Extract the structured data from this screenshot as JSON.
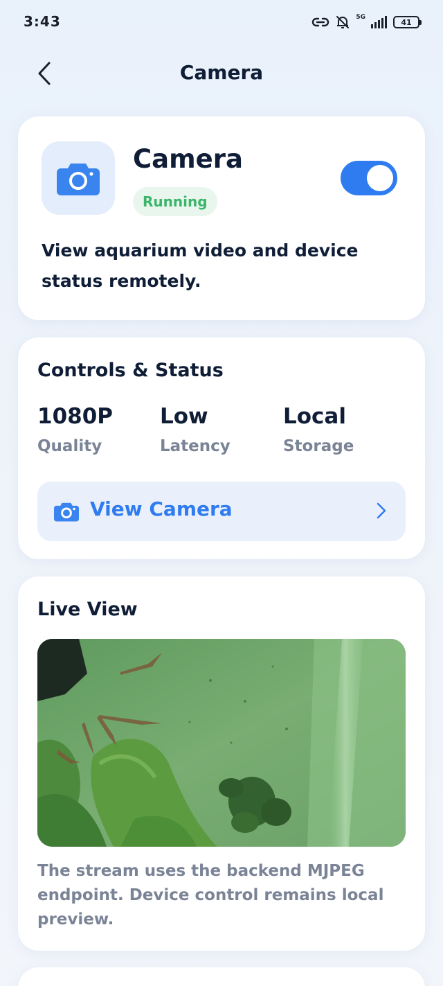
{
  "status_bar": {
    "time": "3:43",
    "network": "5G",
    "battery": "41",
    "icons": [
      "link-icon",
      "bell-muted-icon",
      "signal-icon",
      "battery-icon"
    ]
  },
  "header": {
    "title": "Camera",
    "back_icon": "chevron-left-icon"
  },
  "app_card": {
    "icon": "camera-icon",
    "name": "Camera",
    "status": "Running",
    "enabled": true,
    "description": "View aquarium video and device status remotely."
  },
  "controls": {
    "title": "Controls & Status",
    "stats": [
      {
        "value": "1080P",
        "label": "Quality"
      },
      {
        "value": "Low",
        "label": "Latency"
      },
      {
        "value": "Local",
        "label": "Storage"
      }
    ],
    "view_camera": {
      "label": "View Camera",
      "icon": "camera-icon",
      "chevron": "chevron-right-icon"
    }
  },
  "live_view": {
    "title": "Live View",
    "note": "The stream uses the backend MJPEG endpoint. Device control remains local preview."
  },
  "colors": {
    "accent": "#2f7bf0",
    "running_green": "#3cb56a",
    "text_primary": "#0f1d36",
    "text_secondary": "#7a8496"
  }
}
